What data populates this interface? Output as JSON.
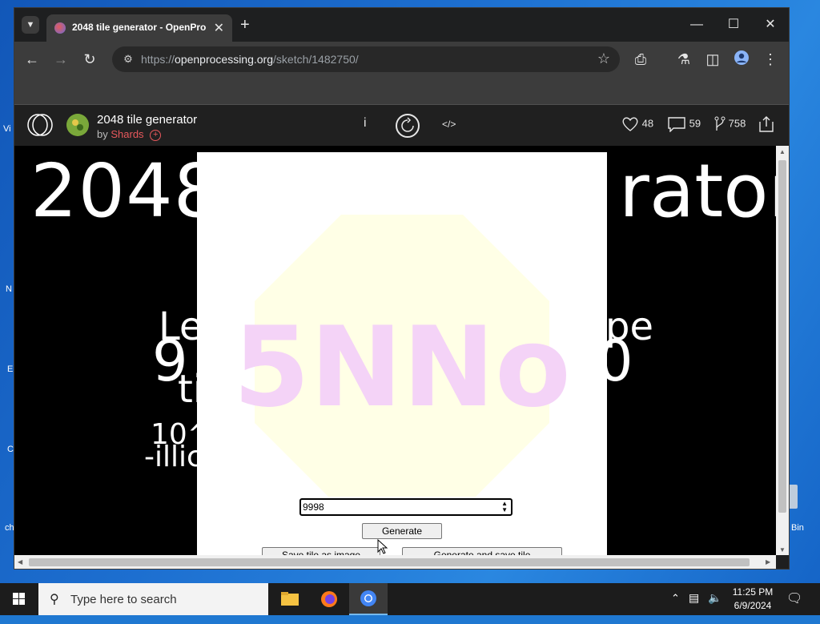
{
  "desktop": {
    "icons_labels_left": [
      "Vi",
      "N",
      "E",
      "C",
      "ch"
    ],
    "recycle_bin_label": "Bin"
  },
  "browser": {
    "tab": {
      "title": "2048 tile generator - OpenPro",
      "close_icon": "close-icon"
    },
    "address": {
      "scheme": "https://",
      "host": "openprocessing.org",
      "path": "/sketch/1482750/"
    }
  },
  "openprocessing": {
    "sketch_title": "2048 tile generator",
    "by_prefix": "by",
    "author": "Shards",
    "follow_symbol": "+",
    "info_symbol": "i",
    "code_symbol": "</>",
    "likes": "48",
    "comments": "59",
    "forks": "758"
  },
  "canvas": {
    "bg_title_left": "2048",
    "bg_title_right": "rator",
    "bg_line1_left": "Le",
    "bg_line1_right": "pe",
    "bg_line2_left": "9",
    "bg_line2_right": "0",
    "bg_line3_left": "ti",
    "bg_line4_left": "10^",
    "bg_line5_left": "-illic",
    "tile_text": "5NNo",
    "number_value": "9998",
    "generate_label": "Generate",
    "save_label": "Save tile as image",
    "generate_save_label": "Generate and save tile"
  },
  "taskbar": {
    "search_placeholder": "Type here to search",
    "time": "11:25 PM",
    "date": "6/9/2024"
  },
  "colors": {
    "tile_octagon": "#ffffe6",
    "tile_text": "#f4d3f7",
    "author": "#e8585c"
  }
}
